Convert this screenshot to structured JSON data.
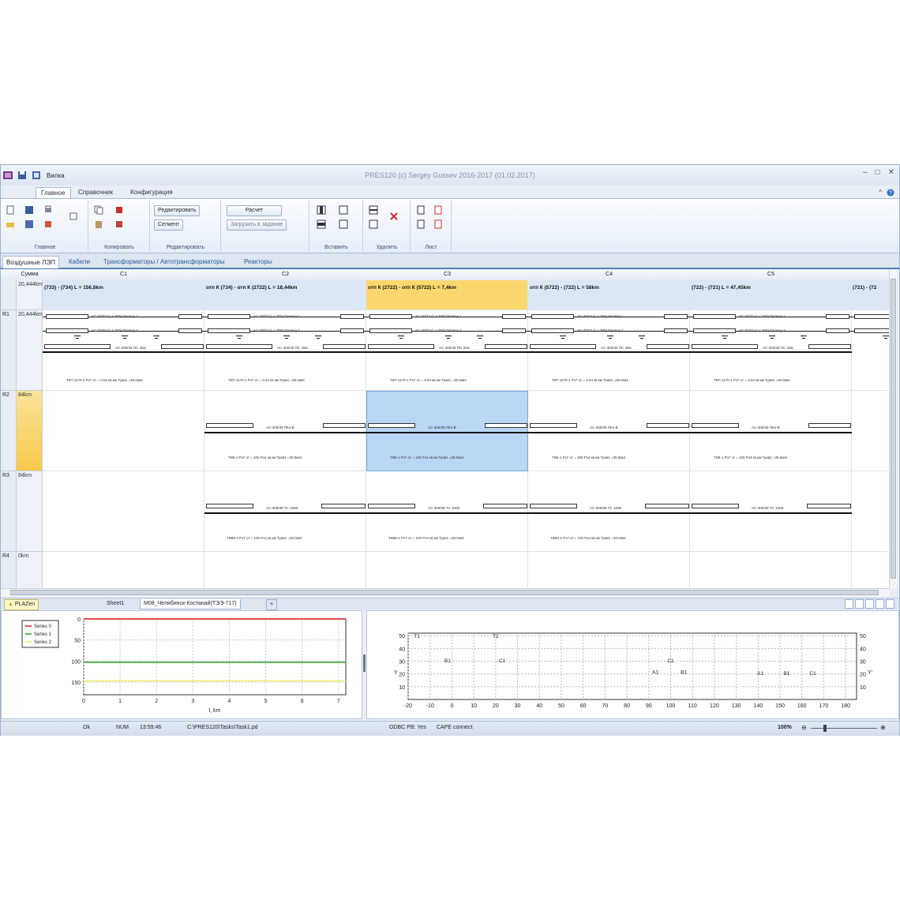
{
  "window": {
    "title": "PRES120 (c) Sergey Gussev 2016-2017 (01.02.2017)",
    "qat_label": "Вилка"
  },
  "ribbon": {
    "tabs": [
      "Главное",
      "Справочник",
      "Конфигурация"
    ],
    "groups": [
      "Главное",
      "Копировать",
      "Редактировать",
      "Вставить",
      "Удалить",
      "Лист"
    ],
    "buttons": {
      "edit": "Редактировать",
      "segment": "Сегмент",
      "calc": "Расчет",
      "calc_task": "Загрузить в задание"
    }
  },
  "doc_tabs": [
    "Воздушные ЛЭП",
    "Кабели",
    "Трансформаторы / Автотрансформаторы",
    "Реакторы"
  ],
  "grid": {
    "sum_header": "Сумма",
    "columns": [
      "C1",
      "C2",
      "C3",
      "C4",
      "C5",
      ""
    ],
    "segment_sum": "20,444km",
    "segments": [
      "(733) - (734) L = 156,8km",
      "отп К (734) - отп К (2722) L = 18,44km",
      "отп К (2722) - отп К (5722) L = 7,4km",
      "отп К (5722) - (722) L = 58km",
      "(722) - (721) L = 47,45km",
      "(721) - (72"
    ],
    "rows": [
      {
        "id": "R1",
        "sum": "20,444km"
      },
      {
        "id": "R2",
        "sum": "84km"
      },
      {
        "id": "R3",
        "sum": "84km"
      },
      {
        "id": "R4",
        "sum": "0km"
      }
    ],
    "tiny": {
      "r1_top": "AC-70/72 (1 x 300) Провод 1",
      "r1_mid": "AC-70/72 (1 x 300) Провод 2",
      "r1_bot": "AC-300/48 ПС 30м",
      "r1_foot": "ТКП 1170-1 Рз7 от = 0.54 кв.км Туав1 =30.0кв4",
      "r2_mid": "AC-300/39 ПК4-В",
      "r2_foot": "ТКВ-1 Рз7 от = 100 Рз4 кв.км Туав1 =30.0кв4",
      "r3_mid": "AC-300/39 ТС 1008",
      "r3_foot": "ТКВ8-1 Рз7 от = 100 Рз4 кв.км Туав1 =30.0кв4"
    }
  },
  "sheets": {
    "left_label": "PLAZen",
    "tabs": [
      "Sheet1",
      "М08_Челябинск-Костанай(ТЭЭ-717)"
    ]
  },
  "chart_data": [
    {
      "type": "line",
      "legend": [
        "Series 0",
        "Series 1",
        "Series 2"
      ],
      "legend_position": "top-left",
      "xlabel": "l, km",
      "x_ticks": [
        0,
        1,
        2,
        3,
        4,
        5,
        6,
        7
      ],
      "y_ticks": [
        0,
        50,
        100,
        150
      ],
      "xlim": [
        0,
        7.2
      ],
      "ylim": [
        0,
        180
      ],
      "y_inverted": true,
      "grid": true,
      "series": [
        {
          "name": "Series 0",
          "color": "#e05050",
          "x": [
            0,
            7.2
          ],
          "y": [
            0,
            0
          ]
        },
        {
          "name": "Series 1",
          "color": "#5ab15a",
          "x": [
            0,
            7.2
          ],
          "y": [
            103,
            103
          ]
        },
        {
          "name": "Series 2",
          "color": "#f3ee8a",
          "x": [
            0,
            7.2
          ],
          "y": [
            147,
            147
          ]
        }
      ]
    },
    {
      "type": "scatter",
      "ylabel": "Y",
      "ylabel_right": "Y'",
      "x_ticks": [
        -20,
        -10,
        0,
        10,
        20,
        30,
        40,
        50,
        60,
        70,
        80,
        90,
        100,
        110,
        120,
        130,
        140,
        150,
        160,
        170,
        180
      ],
      "y_ticks": [
        10,
        20,
        30,
        40,
        50
      ],
      "xlim": [
        -20,
        185
      ],
      "ylim": [
        0,
        52
      ],
      "grid": true,
      "points": [
        {
          "label": "T1",
          "x": -16,
          "y": 50
        },
        {
          "label": "T2",
          "x": 20,
          "y": 50
        },
        {
          "label": "B1",
          "x": -2,
          "y": 31
        },
        {
          "label": "C1",
          "x": 23,
          "y": 31
        },
        {
          "label": "C1",
          "x": 100,
          "y": 31
        },
        {
          "label": "A1",
          "x": 93,
          "y": 22
        },
        {
          "label": "B1",
          "x": 106,
          "y": 22
        },
        {
          "label": "A1",
          "x": 141,
          "y": 21
        },
        {
          "label": "B1",
          "x": 153,
          "y": 21
        },
        {
          "label": "C1",
          "x": 165,
          "y": 21
        }
      ]
    }
  ],
  "status": {
    "ok": "Ok",
    "num": "NUM",
    "time": "13:59:46",
    "path": "C:\\PRES120\\Tasks\\Task1.pd",
    "odbc": "ODBC PB: Yes",
    "cape": "CAPE connect",
    "zoom": "100%"
  }
}
